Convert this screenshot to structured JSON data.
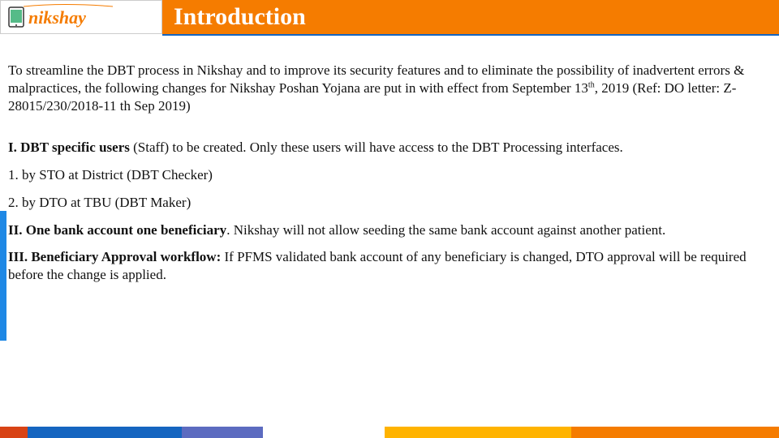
{
  "header": {
    "title": "Introduction",
    "logo_text": "nikshay"
  },
  "content": {
    "intro": "To streamline the DBT process in Nikshay and to improve its security features and to eliminate the possibility of inadvertent errors & malpractices, the following changes for Nikshay Poshan Yojana are put in with effect from September 13",
    "intro_sup": "th",
    "intro_tail": ", 2019 (Ref: DO letter: Z-28015/230/2018-11 th Sep 2019)",
    "p1_lead": "  I. DBT specific users",
    "p1_tail": " (Staff) to be created. Only these users will have access to the DBT Processing interfaces.",
    "p2": "1. by STO at District (DBT Checker)",
    "p3": "2. by DTO at TBU (DBT Maker)",
    "p4_lead": " II. One bank account one beneficiary",
    "p4_tail": ". Nikshay will not allow seeding the same bank account against another patient.",
    "p5_lead": " III. Beneficiary Approval workflow:",
    "p5_tail": " If PFMS validated bank account of any beneficiary is changed, DTO approval will be required before the change is applied."
  },
  "colors": {
    "header_bg": "#F57C00",
    "accent_blue": "#1565C0"
  }
}
